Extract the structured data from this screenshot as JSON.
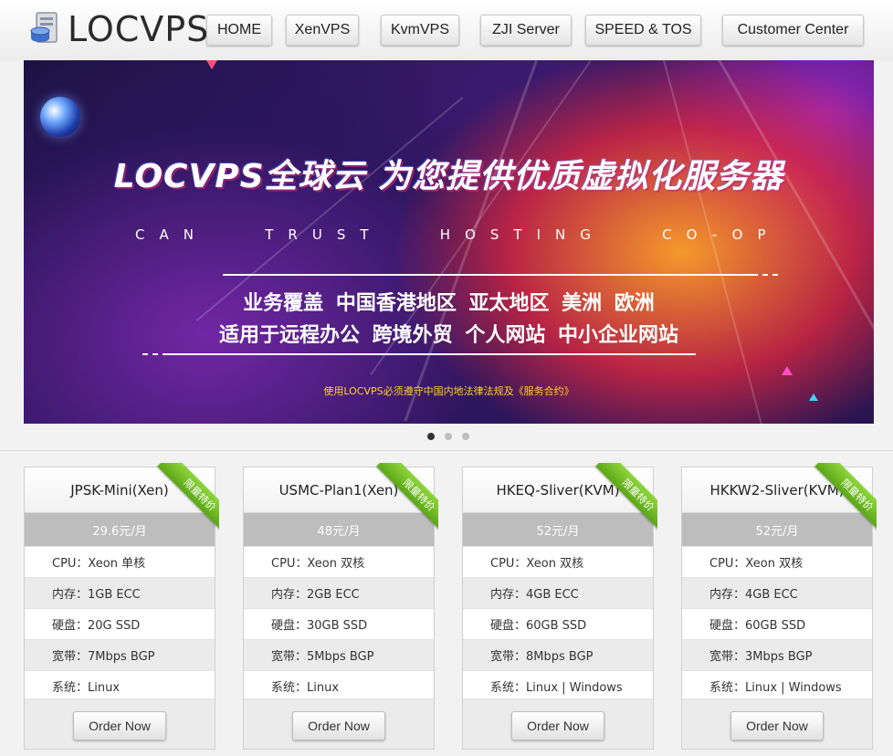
{
  "header": {
    "logo_text": "LOCVPS",
    "nav": [
      {
        "label": "HOME"
      },
      {
        "label": "XenVPS"
      },
      {
        "label": "KvmVPS"
      },
      {
        "label": "ZJI Server"
      },
      {
        "label": "SPEED & TOS"
      },
      {
        "label": "Customer Center"
      }
    ]
  },
  "banner": {
    "title": "LOCVPS全球云 为您提供优质虚拟化服务器",
    "subtitle": "CAN   TRUST   HOSTING   CO-OP",
    "line1": "业务覆盖 中国香港地区 亚太地区 美洲 欧洲",
    "line2": "适用于远程办公 跨境外贸 个人网站 中小企业网站",
    "note": "使用LOCVPS必须遵守中国内地法律法规及《服务合约》",
    "colors": {
      "note": "#ffd21e",
      "accent": "#ff9a1f"
    }
  },
  "slider": {
    "dots": 3,
    "active": 1
  },
  "plans": [
    {
      "name": "JPSK-Mini(Xen)",
      "ribbon": "限量特价",
      "price": "29.6元/月",
      "specs": [
        "CPU：Xeon 单核",
        "内存：1GB ECC",
        "硬盘：20G SSD",
        "宽带：7Mbps BGP",
        "系统：Linux"
      ],
      "order_label": "Order Now"
    },
    {
      "name": "USMC-Plan1(Xen)",
      "ribbon": "限量特价",
      "price": "48元/月",
      "specs": [
        "CPU：Xeon 双核",
        "内存：2GB ECC",
        "硬盘：30GB SSD",
        "宽带：5Mbps BGP",
        "系统：Linux"
      ],
      "order_label": "Order Now"
    },
    {
      "name": "HKEQ-Sliver(KVM)",
      "ribbon": "限量特价",
      "price": "52元/月",
      "specs": [
        "CPU：Xeon 双核",
        "内存：4GB ECC",
        "硬盘：60GB SSD",
        "宽带：8Mbps BGP",
        "系统：Linux | Windows"
      ],
      "order_label": "Order Now"
    },
    {
      "name": "HKKW2-Sliver(KVM)",
      "ribbon": "限量特价",
      "price": "52元/月",
      "specs": [
        "CPU：Xeon 双核",
        "内存：4GB ECC",
        "硬盘：60GB SSD",
        "宽带：3Mbps BGP",
        "系统：Linux | Windows"
      ],
      "order_label": "Order Now"
    }
  ]
}
